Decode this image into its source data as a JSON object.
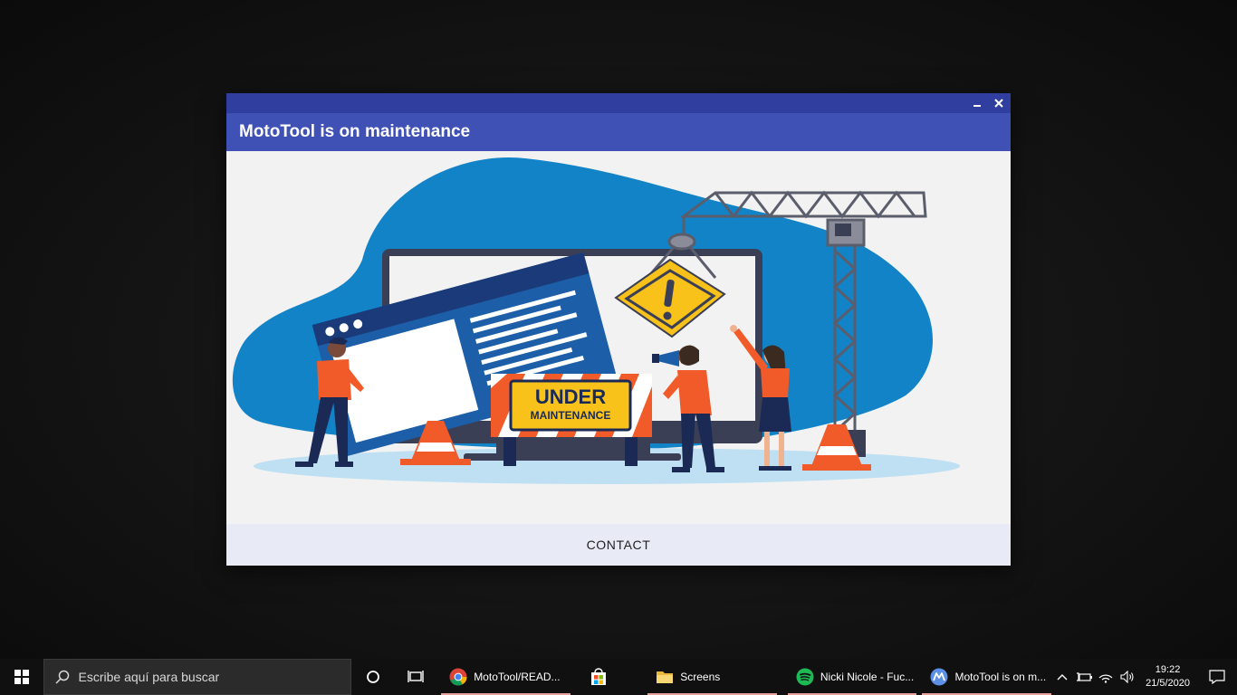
{
  "dialog": {
    "title": "MotoTool is on maintenance",
    "sign_line1": "UNDER",
    "sign_line2": "MAINTENANCE",
    "contact_label": "CONTACT"
  },
  "colors": {
    "titlebar": "#303f9f",
    "header": "#3f51b5",
    "footer": "#e8eaf6",
    "blob": "#1283c6",
    "accent_orange": "#f15a29",
    "warning_yellow": "#f9c21a"
  },
  "taskbar": {
    "search_placeholder": "Escribe aquí para buscar",
    "tasks": [
      {
        "label": "MotoTool/READ...",
        "icon": "chrome-icon"
      },
      {
        "label": "",
        "icon": "store-icon"
      },
      {
        "label": "Screens",
        "icon": "folder-icon"
      },
      {
        "label": "Nicki Nicole - Fuc...",
        "icon": "spotify-icon"
      },
      {
        "label": "MotoTool is on m...",
        "icon": "motorola-icon"
      }
    ],
    "time": "19:22",
    "date": "21/5/2020"
  }
}
